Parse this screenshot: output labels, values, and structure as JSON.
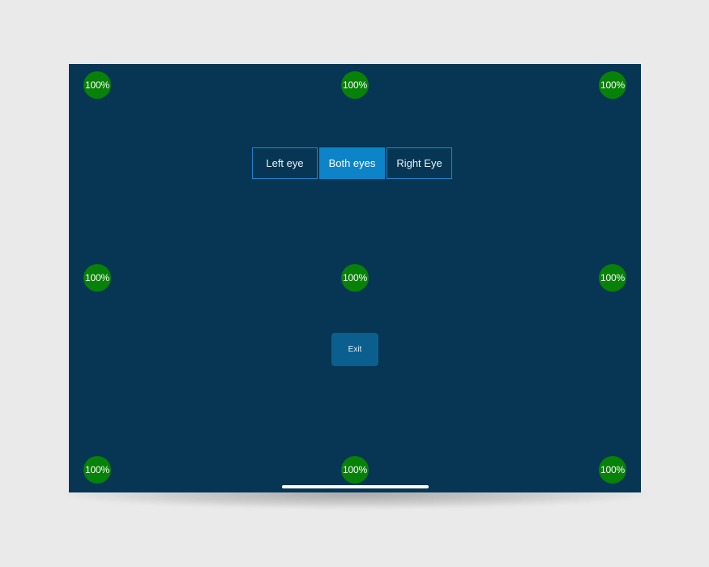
{
  "theme": {
    "background": "#eaeaea",
    "screen_background": "#063654",
    "target_color": "#078107",
    "segment_active": "#0d84c8",
    "segment_border": "#1e86c8",
    "exit_button": "#0b5f8e"
  },
  "eye_selector": {
    "options": [
      {
        "label": "Left eye",
        "selected": false
      },
      {
        "label": "Both eyes",
        "selected": true
      },
      {
        "label": "Right Eye",
        "selected": false
      }
    ]
  },
  "calibration_targets": [
    {
      "label": "100%",
      "score": 100
    },
    {
      "label": "100%",
      "score": 100
    },
    {
      "label": "100%",
      "score": 100
    },
    {
      "label": "100%",
      "score": 100
    },
    {
      "label": "100%",
      "score": 100
    },
    {
      "label": "100%",
      "score": 100
    },
    {
      "label": "100%",
      "score": 100
    },
    {
      "label": "100%",
      "score": 100
    },
    {
      "label": "100%",
      "score": 100
    }
  ],
  "exit_button": {
    "label": "Exit"
  }
}
